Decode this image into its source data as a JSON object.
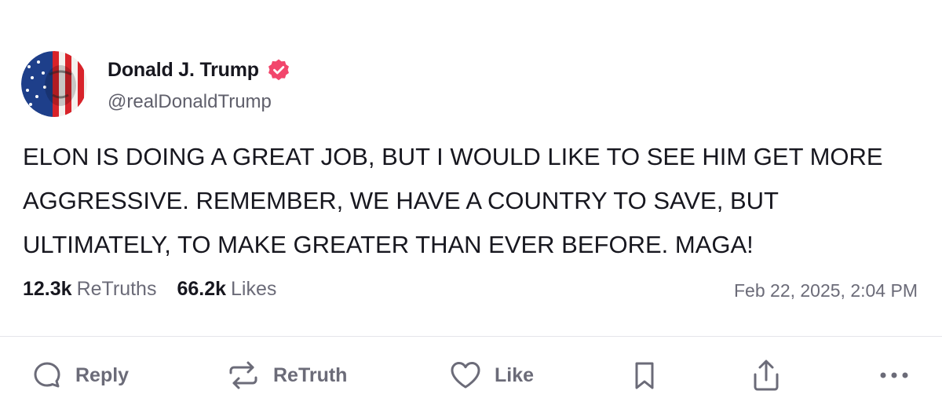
{
  "author": {
    "name": "Donald J. Trump",
    "handle": "@realDonaldTrump",
    "verified_icon": "verified-badge-icon",
    "verified_color": "#f2466c"
  },
  "post": {
    "text": "ELON IS DOING A GREAT JOB, BUT I WOULD LIKE TO SEE HIM GET MORE AGGRESSIVE. REMEMBER, WE HAVE A COUNTRY TO SAVE, BUT ULTIMATELY, TO MAKE GREATER THAN EVER BEFORE. MAGA!"
  },
  "stats": {
    "retruths_count": "12.3k",
    "retruths_label": "ReTruths",
    "likes_count": "66.2k",
    "likes_label": "Likes"
  },
  "timestamp": "Feb 22, 2025, 2:04 PM",
  "actions": {
    "reply_label": "Reply",
    "retruth_label": "ReTruth",
    "like_label": "Like"
  },
  "colors": {
    "text": "#17171f",
    "muted": "#6b6b78",
    "divider": "#e5e5ea"
  }
}
